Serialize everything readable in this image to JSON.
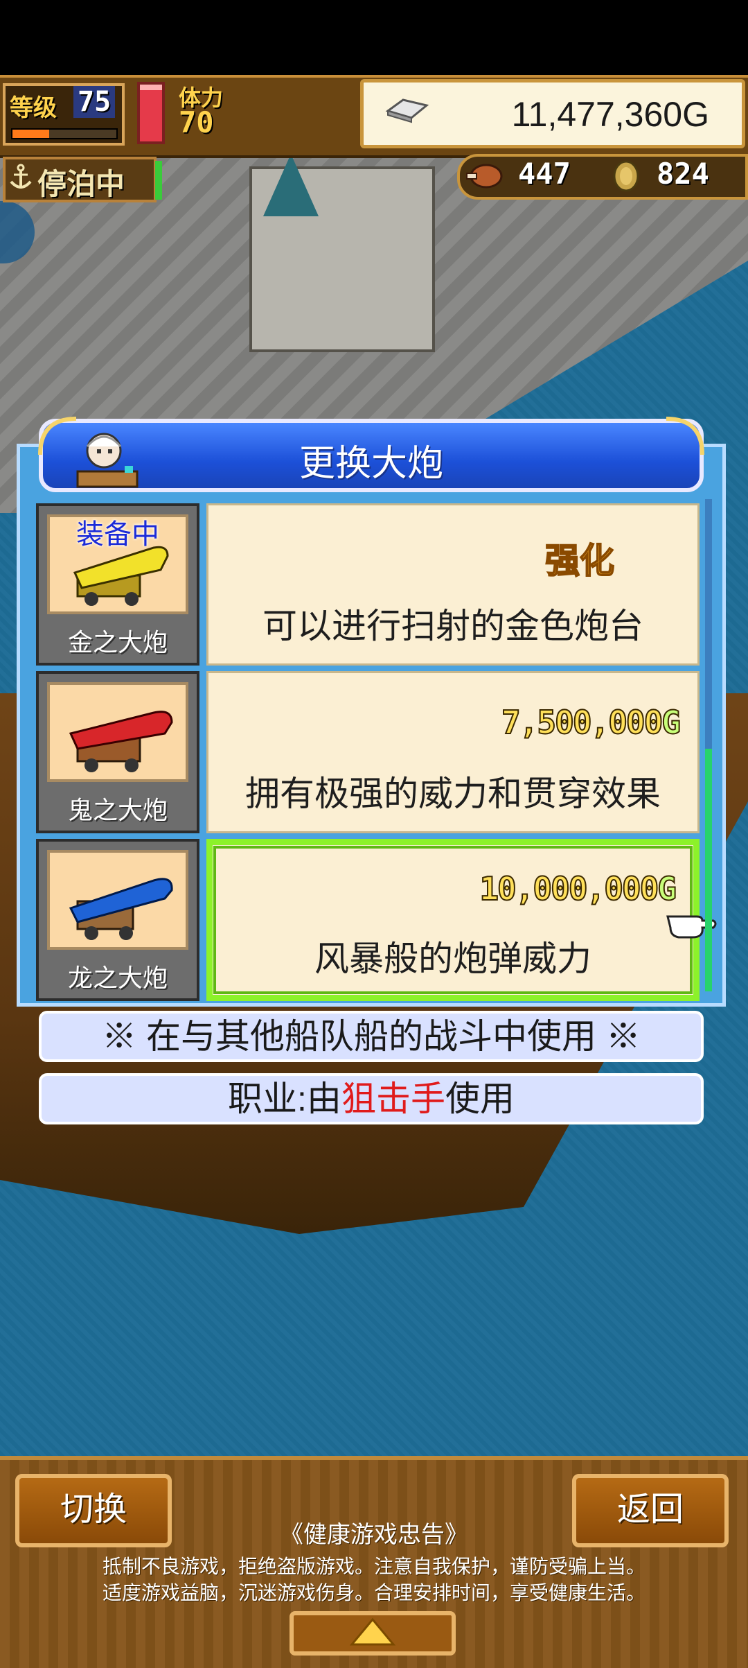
{
  "hud": {
    "level_label": "等级",
    "level": "75",
    "level_progress": 0.35,
    "hp_fill": 0.9,
    "stamina_label": "体力",
    "stamina": "70",
    "gold": "11,477,360G",
    "status": "停泊中",
    "food": "447",
    "coins": "824"
  },
  "dialog": {
    "title": "更换大炮",
    "items": [
      {
        "tag": "装备中",
        "name": "金之大炮",
        "price": "",
        "action": "强化",
        "desc": "可以进行扫射的金色炮台",
        "color": "#f2e12a"
      },
      {
        "tag": "",
        "name": "鬼之大炮",
        "price": "7,500,000",
        "price_suffix": "G",
        "desc": "拥有极强的威力和贯穿效果",
        "color": "#d8262a"
      },
      {
        "tag": "",
        "name": "龙之大炮",
        "price": "10,000,000",
        "price_suffix": "G",
        "desc": "风暴般的炮弹威力",
        "color": "#1f63d6"
      }
    ],
    "note1": "※ 在与其他船队船的战斗中使用 ※",
    "note2_prefix": "职业:由",
    "note2_job": "狙击手",
    "note2_suffix": "使用"
  },
  "bottom": {
    "switch_label": "切换",
    "back_label": "返回",
    "advice_title": "《健康游戏忠告》",
    "advice_line1": "抵制不良游戏，拒绝盗版游戏。注意自我保护，谨防受骗上当。",
    "advice_line2": "适度游戏益脑，沉迷游戏伤身。合理安排时间，享受健康生活。"
  }
}
